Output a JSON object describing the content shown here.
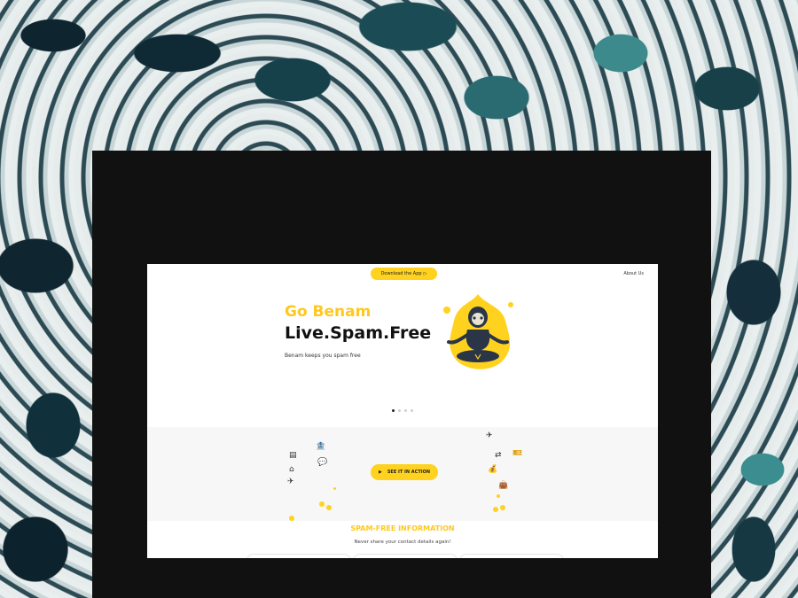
{
  "header": {
    "download_label": "Download the App",
    "about_label": "About Us"
  },
  "hero": {
    "title_line1": "Go Benam",
    "title_line2": "Live.Spam.Free",
    "subtitle": "Benam keeps you spam free",
    "carousel_total": 4,
    "carousel_active": 1
  },
  "feature_band": {
    "see_action_label": "SEE IT IN ACTION",
    "icons": [
      "bank-icon",
      "atm-icon",
      "building-icon",
      "chat-bubbles-icon",
      "airplane-icon",
      "airplane-icon",
      "money-exchange-icon",
      "ticket-icon",
      "money-bag-icon",
      "shopping-bag-icon"
    ]
  },
  "info": {
    "title": "SPAM-FREE INFORMATION",
    "subtitle": "Never share your contact details again!"
  },
  "colors": {
    "accent": "#ffd21f",
    "accent_text": "#ffc81e",
    "frame": "#111111"
  }
}
